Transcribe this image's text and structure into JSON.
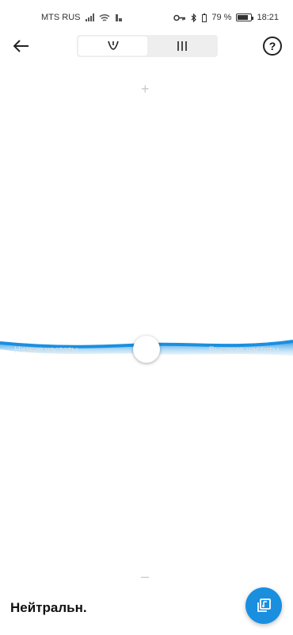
{
  "status_bar": {
    "carrier": "MTS RUS",
    "battery_percent": "79 %",
    "time": "18:21",
    "icons": [
      "signal-icon",
      "wifi-icon",
      "vpn-key-icon",
      "bluetooth-icon",
      "battery-icon"
    ]
  },
  "top_bar": {
    "mode_tabs": [
      {
        "name": "curve-mode",
        "icon": "curve-icon",
        "selected": true
      },
      {
        "name": "bands-mode",
        "icon": "bars-icon",
        "selected": false
      }
    ],
    "help_label": "?"
  },
  "equalizer": {
    "plus_label": "+",
    "minus_label": "–",
    "low_label": "Низкие частоты",
    "high_label": "Высокие частоты",
    "colors": {
      "accent": "#1a8fe0",
      "wave_light": "#9fd3f5"
    }
  },
  "footer": {
    "preset_name": "Нейтральн.",
    "fab_icon": "presets-icon"
  }
}
